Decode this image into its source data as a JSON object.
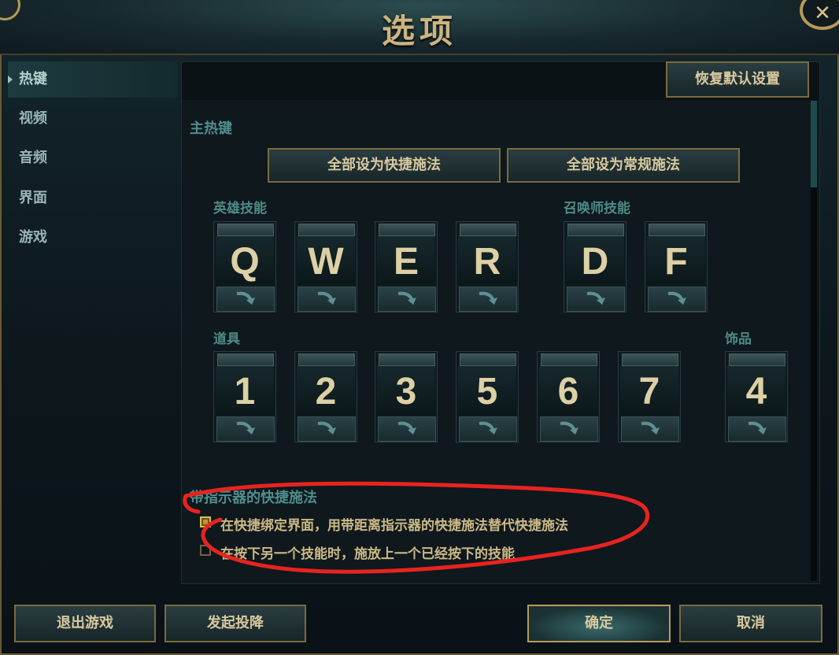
{
  "window": {
    "title": "选项",
    "close_glyph": "✕"
  },
  "sidebar": {
    "items": [
      {
        "label": "热键",
        "active": true
      },
      {
        "label": "视频"
      },
      {
        "label": "音频"
      },
      {
        "label": "界面"
      },
      {
        "label": "游戏"
      }
    ]
  },
  "toolbar": {
    "restore_defaults_label": "恢复默认设置"
  },
  "hotkeys": {
    "section_title": "主热键",
    "set_all_quick_label": "全部设为快捷施法",
    "set_all_normal_label": "全部设为常规施法",
    "champion_abilities": {
      "title": "英雄技能",
      "keys": [
        "Q",
        "W",
        "E",
        "R"
      ]
    },
    "summoner_spells": {
      "title": "召唤师技能",
      "keys": [
        "D",
        "F"
      ]
    },
    "items": {
      "title": "道具",
      "keys": [
        "1",
        "2",
        "3",
        "5",
        "6",
        "7"
      ]
    },
    "trinket": {
      "title": "饰品",
      "keys": [
        "4"
      ]
    }
  },
  "quickcast_indicator": {
    "section_title": "带指示器的快捷施法",
    "options": [
      {
        "label": "在快捷绑定界面，用带距离指示器的快捷施法替代快捷施法",
        "checked": true
      },
      {
        "label": "在按下另一个技能时，施放上一个已经按下的技能",
        "checked": false
      }
    ]
  },
  "footer": {
    "exit_game_label": "退出游戏",
    "surrender_label": "发起投降",
    "confirm_label": "确定",
    "cancel_label": "取消"
  },
  "colors": {
    "accent_gold": "#cbb481",
    "label_teal": "#4f8f8c",
    "annotation_red": "#e8231f"
  }
}
